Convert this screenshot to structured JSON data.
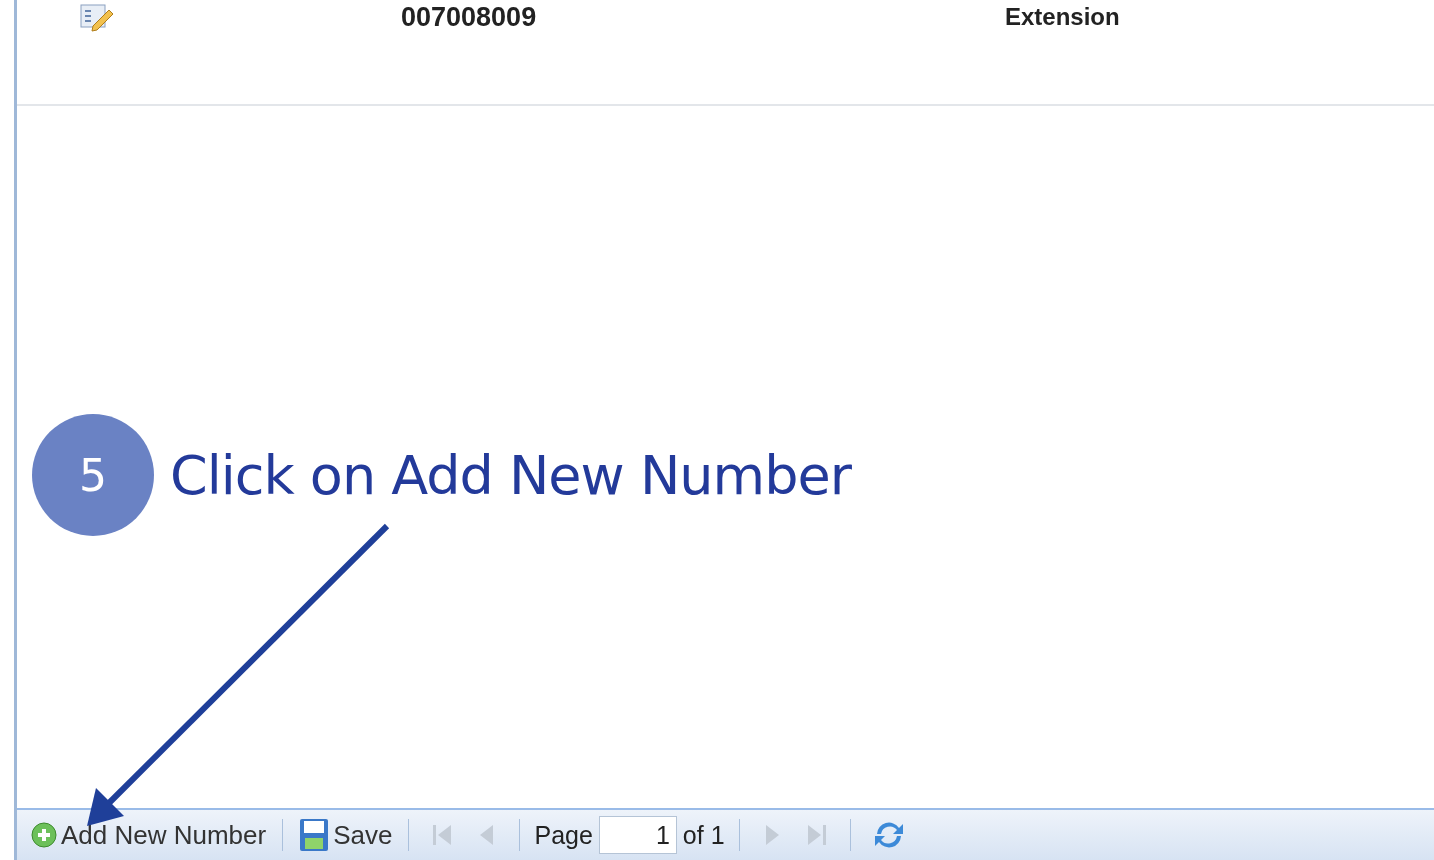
{
  "grid": {
    "rows": [
      {
        "number": "007008009",
        "type": "Extension"
      }
    ]
  },
  "annotation": {
    "step": "5",
    "text": "Click on Add New Number"
  },
  "toolbar": {
    "buttons": [
      {
        "kind": "add",
        "label": "Add New Number"
      },
      {
        "kind": "save",
        "label": "Save"
      }
    ],
    "nav": [
      {
        "kind": "first",
        "disabled": true
      },
      {
        "kind": "prev",
        "disabled": true
      }
    ],
    "page_label": "Page",
    "page_value": "1",
    "page_total": "of 1",
    "nav_after": [
      {
        "kind": "next",
        "disabled": true
      },
      {
        "kind": "last",
        "disabled": true
      }
    ]
  }
}
